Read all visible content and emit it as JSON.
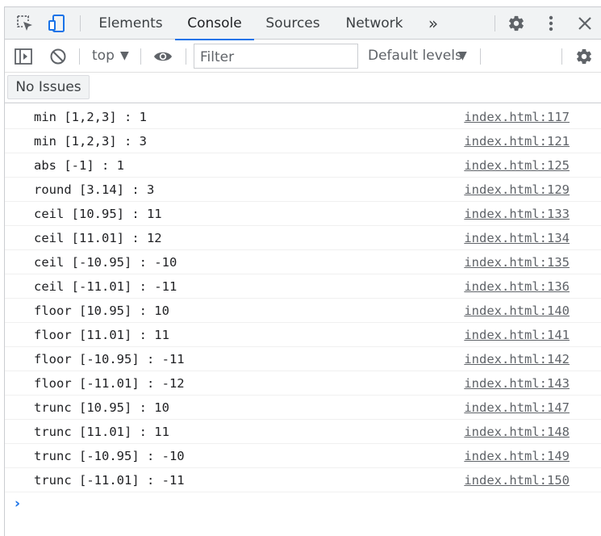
{
  "tabs": [
    {
      "label": "Elements"
    },
    {
      "label": "Console",
      "active": true
    },
    {
      "label": "Sources"
    },
    {
      "label": "Network"
    }
  ],
  "more_tabs": "»",
  "toolbar": {
    "context": "top",
    "filter_placeholder": "Filter",
    "levels": "Default levels"
  },
  "issues_label": "No Issues",
  "console_rows": [
    {
      "msg": "min [1,2,3] : 1",
      "src": "index.html:117"
    },
    {
      "msg": "min [1,2,3] : 3",
      "src": "index.html:121"
    },
    {
      "msg": "abs [-1] : 1",
      "src": "index.html:125"
    },
    {
      "msg": "round [3.14] : 3",
      "src": "index.html:129"
    },
    {
      "msg": "ceil [10.95] : 11",
      "src": "index.html:133"
    },
    {
      "msg": "ceil [11.01] : 12",
      "src": "index.html:134"
    },
    {
      "msg": "ceil [-10.95] : -10",
      "src": "index.html:135"
    },
    {
      "msg": "ceil [-11.01] : -11",
      "src": "index.html:136"
    },
    {
      "msg": "floor [10.95] : 10",
      "src": "index.html:140"
    },
    {
      "msg": "floor [11.01] : 11",
      "src": "index.html:141"
    },
    {
      "msg": "floor [-10.95] : -11",
      "src": "index.html:142"
    },
    {
      "msg": "floor [-11.01] : -12",
      "src": "index.html:143"
    },
    {
      "msg": "trunc [10.95] : 10",
      "src": "index.html:147"
    },
    {
      "msg": "trunc [11.01] : 11",
      "src": "index.html:148"
    },
    {
      "msg": "trunc [-10.95] : -10",
      "src": "index.html:149"
    },
    {
      "msg": "trunc [-11.01] : -11",
      "src": "index.html:150"
    }
  ],
  "prompt_symbol": "›",
  "colors": {
    "accent": "#1a73e8",
    "link": "#5f6368"
  },
  "icons": [
    "inspect-element-icon",
    "device-toolbar-icon",
    "settings-gear-icon",
    "more-vertical-icon",
    "close-icon",
    "sidebar-toggle-icon",
    "clear-console-icon",
    "live-expression-eye-icon",
    "console-settings-gear-icon"
  ]
}
